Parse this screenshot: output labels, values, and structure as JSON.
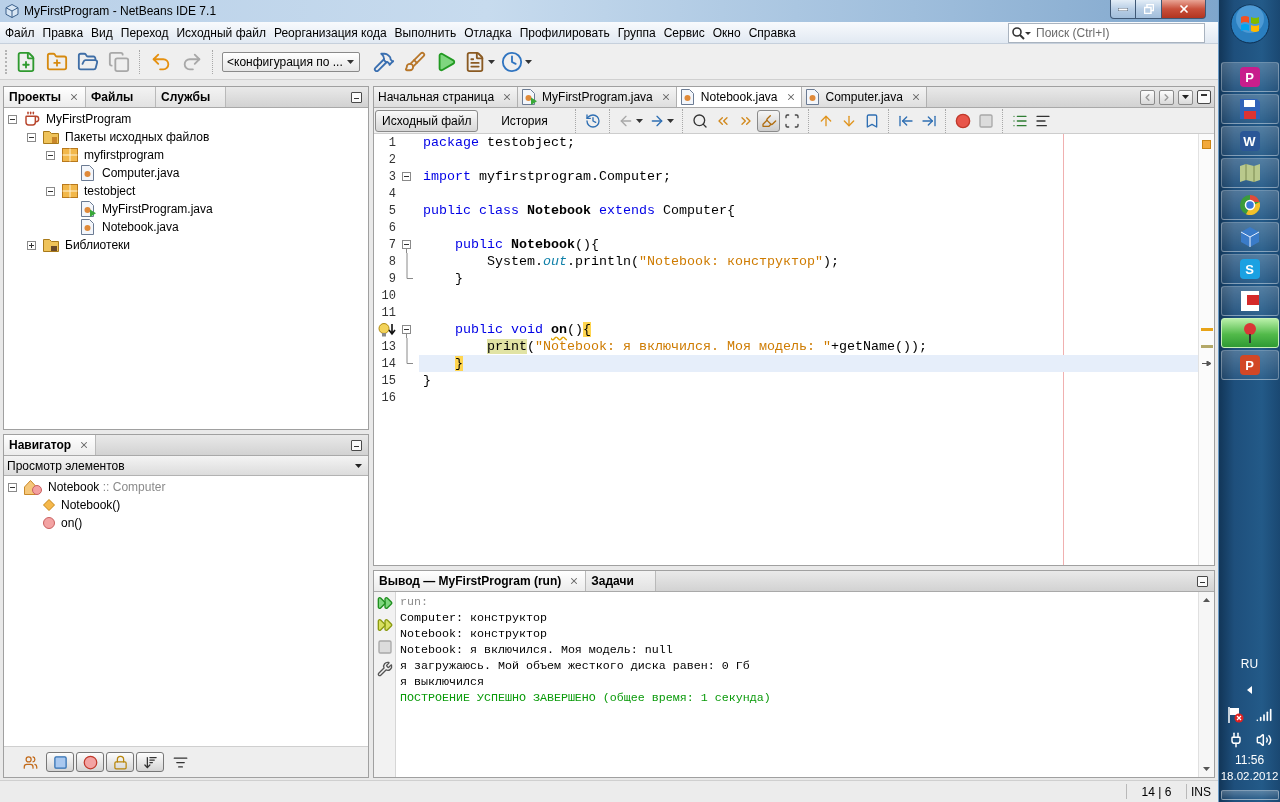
{
  "window": {
    "title": "MyFirstProgram - NetBeans IDE 7.1"
  },
  "menu": [
    "Файл",
    "Правка",
    "Вид",
    "Переход",
    "Исходный файл",
    "Реорганизация кода",
    "Выполнить",
    "Отладка",
    "Профилировать",
    "Группа",
    "Сервис",
    "Окно",
    "Справка"
  ],
  "search": {
    "placeholder": "Поиск (Ctrl+I)"
  },
  "toolbar": {
    "groups": [
      [
        {
          "kind": "new-file",
          "disabled": false,
          "dropdown": false
        },
        {
          "kind": "new-project",
          "disabled": false,
          "dropdown": false
        },
        {
          "kind": "open-project",
          "disabled": false,
          "dropdown": false
        },
        {
          "kind": "close-project",
          "disabled": true,
          "dropdown": false
        }
      ],
      [
        {
          "kind": "undo",
          "disabled": false,
          "dropdown": false
        },
        {
          "kind": "redo",
          "disabled": true,
          "dropdown": false
        }
      ],
      [
        {
          "kind": "config",
          "value": "<конфигурация по ..."
        },
        {
          "kind": "build",
          "disabled": false,
          "dropdown": false
        },
        {
          "kind": "clean-build",
          "disabled": false,
          "dropdown": false
        },
        {
          "kind": "run",
          "disabled": false,
          "dropdown": false
        },
        {
          "kind": "debug",
          "disabled": false,
          "dropdown": true
        },
        {
          "kind": "profile",
          "disabled": false,
          "dropdown": true
        }
      ]
    ]
  },
  "projects": {
    "tabs": [
      {
        "label": "Проекты",
        "selected": true,
        "closable": true
      },
      {
        "label": "Файлы",
        "selected": false,
        "closable": false
      },
      {
        "label": "Службы",
        "selected": false,
        "closable": false
      }
    ],
    "tree": [
      {
        "label": "MyFirstProgram",
        "kind": "project",
        "expanded": true,
        "children": [
          {
            "label": "Пакеты исходных файлов",
            "kind": "source-root",
            "expanded": true,
            "children": [
              {
                "label": "myfirstprogram",
                "kind": "package",
                "expanded": true,
                "children": [
                  {
                    "label": "Computer.java",
                    "kind": "java"
                  }
                ]
              },
              {
                "label": "testobject",
                "kind": "package",
                "expanded": true,
                "children": [
                  {
                    "label": "MyFirstProgram.java",
                    "kind": "java-main"
                  },
                  {
                    "label": "Notebook.java",
                    "kind": "java"
                  }
                ]
              }
            ]
          },
          {
            "label": "Библиотеки",
            "kind": "libraries",
            "expanded": false
          }
        ]
      }
    ]
  },
  "navigator": {
    "tabs": [
      {
        "label": "Навигатор",
        "selected": true,
        "closable": true
      }
    ],
    "view": "Просмотр элементов",
    "tree": [
      {
        "label": "Notebook",
        "detail": ":: Computer",
        "kind": "class",
        "expanded": true,
        "children": [
          {
            "label": "Notebook()",
            "kind": "constructor"
          },
          {
            "label": "on()",
            "kind": "method"
          }
        ]
      }
    ],
    "filters": [
      {
        "kind": "inherited",
        "on": false
      },
      {
        "kind": "fields",
        "on": true
      },
      {
        "kind": "static",
        "on": true
      },
      {
        "kind": "private",
        "on": true
      },
      {
        "kind": "sort-name",
        "on": true
      },
      {
        "kind": "sort-source",
        "on": false
      }
    ]
  },
  "editor": {
    "tabs": [
      {
        "label": "Начальная страница",
        "kind": "page",
        "selected": false
      },
      {
        "label": "MyFirstProgram.java",
        "kind": "java-main",
        "selected": false
      },
      {
        "label": "Notebook.java",
        "kind": "java",
        "selected": true
      },
      {
        "label": "Computer.java",
        "kind": "java",
        "selected": false
      }
    ],
    "views": [
      {
        "label": "Исходный файл",
        "selected": true
      },
      {
        "label": "История",
        "selected": false
      }
    ],
    "tools": [
      [
        {
          "kind": "last-edit",
          "disabled": false,
          "pressed": false,
          "dropdown": false
        }
      ],
      [
        {
          "kind": "back",
          "disabled": true,
          "pressed": false,
          "dropdown": true
        },
        {
          "kind": "forward",
          "disabled": false,
          "pressed": false,
          "dropdown": true
        }
      ],
      [
        {
          "kind": "find-selection",
          "disabled": false,
          "pressed": false,
          "dropdown": false
        },
        {
          "kind": "find-previous",
          "disabled": false,
          "pressed": false,
          "dropdown": false
        },
        {
          "kind": "find-next",
          "disabled": false,
          "pressed": false,
          "dropdown": false
        },
        {
          "kind": "highlight",
          "disabled": false,
          "pressed": true,
          "dropdown": false
        },
        {
          "kind": "rectangular-selection",
          "disabled": false,
          "pressed": false,
          "dropdown": false
        }
      ],
      [
        {
          "kind": "previous-bookmark",
          "disabled": false,
          "pressed": false,
          "dropdown": false
        },
        {
          "kind": "next-bookmark",
          "disabled": false,
          "pressed": false,
          "dropdown": false
        },
        {
          "kind": "toggle-bookmark",
          "disabled": false,
          "pressed": false,
          "dropdown": false
        }
      ],
      [
        {
          "kind": "shift-left",
          "disabled": false,
          "pressed": false,
          "dropdown": false
        },
        {
          "kind": "shift-right",
          "disabled": false,
          "pressed": false,
          "dropdown": false
        }
      ],
      [
        {
          "kind": "record-macro",
          "disabled": false,
          "pressed": false,
          "dropdown": false
        },
        {
          "kind": "stop-macro",
          "disabled": true,
          "pressed": false,
          "dropdown": false
        }
      ],
      [
        {
          "kind": "comment",
          "disabled": false,
          "pressed": false,
          "dropdown": false
        },
        {
          "kind": "uncomment",
          "disabled": false,
          "pressed": false,
          "dropdown": false
        }
      ]
    ],
    "lines": [
      {
        "number": "1",
        "kind": "plain",
        "hint": false,
        "tokens": [
          {
            "text": "package",
            "kind": "keyword"
          },
          {
            "text": " testobject;",
            "kind": "plain"
          }
        ],
        "current": false
      },
      {
        "number": "2",
        "kind": "plain",
        "hint": false,
        "current": false
      },
      {
        "number": "3",
        "kind": "fold-start",
        "hint": false,
        "tokens": [
          {
            "text": "import",
            "kind": "keyword"
          },
          {
            "text": " myfirstprogram.Computer;",
            "kind": "plain"
          }
        ],
        "current": false
      },
      {
        "number": "4",
        "kind": "plain",
        "hint": false,
        "current": false
      },
      {
        "number": "5",
        "kind": "plain",
        "hint": false,
        "tokens": [
          {
            "text": "public",
            "kind": "keyword"
          },
          {
            "text": " class",
            "kind": "keyword"
          },
          {
            "text": " Notebook",
            "kind": "name"
          },
          {
            "text": " extends",
            "kind": "keyword"
          },
          {
            "text": " Computer{",
            "kind": "plain"
          }
        ],
        "current": false
      },
      {
        "number": "6",
        "kind": "plain",
        "hint": false,
        "current": false
      },
      {
        "number": "7",
        "kind": "fold-start",
        "hint": false,
        "tokens": [
          {
            "text": "    public",
            "kind": "keyword"
          },
          {
            "text": " Notebook",
            "kind": "name"
          },
          {
            "text": "(){",
            "kind": "plain"
          }
        ],
        "current": false
      },
      {
        "number": "8",
        "kind": "fold-body",
        "hint": false,
        "tokens": [
          {
            "text": "        System.",
            "kind": "plain"
          },
          {
            "text": "out",
            "kind": "field"
          },
          {
            "text": ".println(",
            "kind": "plain"
          },
          {
            "text": "\"Notebook: конструктор\"",
            "kind": "string"
          },
          {
            "text": ");",
            "kind": "plain"
          }
        ],
        "current": false
      },
      {
        "number": "9",
        "kind": "fold-end",
        "hint": false,
        "tokens": [
          {
            "text": "    }",
            "kind": "plain"
          }
        ],
        "current": false
      },
      {
        "number": "10",
        "kind": "plain",
        "hint": false,
        "current": false
      },
      {
        "number": "11",
        "kind": "plain",
        "hint": false,
        "current": false
      },
      {
        "kind": "fold-start",
        "hint": true,
        "tokens": [
          {
            "text": "    public",
            "kind": "keyword"
          },
          {
            "text": " void",
            "kind": "keyword"
          },
          {
            "text": " on",
            "kind": "hinted-name"
          },
          {
            "text": "()",
            "kind": "plain"
          },
          {
            "text": "{",
            "kind": "brace"
          }
        ],
        "current": false
      },
      {
        "number": "13",
        "kind": "fold-body",
        "hint": false,
        "tokens": [
          {
            "text": "        print",
            "kind": "call"
          },
          {
            "text": "(",
            "kind": "plain"
          },
          {
            "text": "\"Notebook: я включился. Моя модель: \"",
            "kind": "string"
          },
          {
            "text": "+getName());",
            "kind": "plain"
          }
        ],
        "current": false
      },
      {
        "number": "14",
        "kind": "fold-end",
        "hint": false,
        "tokens": [
          {
            "text": "    }",
            "kind": "brace"
          }
        ],
        "current": true
      },
      {
        "number": "15",
        "kind": "plain",
        "hint": false,
        "tokens": [
          {
            "text": "}",
            "kind": "plain"
          }
        ],
        "current": false
      },
      {
        "number": "16",
        "kind": "plain",
        "hint": false,
        "current": false
      }
    ]
  },
  "output": {
    "tabs": [
      {
        "label": "Вывод — MyFirstProgram (run)",
        "selected": true,
        "closable": true
      },
      {
        "label": "Задачи",
        "selected": false,
        "closable": false
      }
    ],
    "actions": [
      {
        "kind": "rerun",
        "disabled": false
      },
      {
        "kind": "rerun-options",
        "disabled": false
      },
      {
        "kind": "stop",
        "disabled": true
      },
      {
        "kind": "settings",
        "disabled": false
      }
    ],
    "lines": [
      {
        "text": "run:",
        "kind": "meta"
      },
      {
        "text": "Computer: конструктор",
        "kind": "plain"
      },
      {
        "text": "Notebook: конструктор",
        "kind": "plain"
      },
      {
        "text": "Notebook: я включился. Моя модель: null",
        "kind": "plain"
      },
      {
        "text": "я загружаюсь. Мой объем жесткого диска равен: 0 Гб",
        "kind": "plain"
      },
      {
        "text": "я выключился",
        "kind": "plain"
      },
      {
        "text": "ПОСТРОЕНИЕ УСПЕШНО ЗАВЕРШЕНО (общее время: 1 секунда)",
        "kind": "success"
      }
    ]
  },
  "status_bar": {
    "position": "14 | 6",
    "mode": "INS"
  },
  "taskbar": {
    "apps": [
      {
        "kind": "letter",
        "glyph": "P",
        "color": "#c81e8c",
        "selected": false
      },
      {
        "kind": "disk",
        "color": "#2f62b8",
        "selected": false
      },
      {
        "kind": "letter",
        "glyph": "W",
        "color": "#2b5797",
        "selected": false
      },
      {
        "kind": "map",
        "color": "#b9c98c",
        "selected": false
      },
      {
        "kind": "globe",
        "color": "#3b9b3b",
        "selected": false
      },
      {
        "kind": "cube",
        "color": "#3a7bc8",
        "selected": false
      },
      {
        "kind": "letter",
        "glyph": "S",
        "color": "#1ba1e2",
        "selected": false
      },
      {
        "kind": "page",
        "color": "#d42a2a",
        "selected": false
      },
      {
        "kind": "pin",
        "color": "#d93636",
        "selected": true
      },
      {
        "kind": "letter",
        "glyph": "P",
        "color": "#d24726",
        "selected": false
      }
    ],
    "language": "RU",
    "time": "11:56",
    "date": "18.02.2012"
  }
}
